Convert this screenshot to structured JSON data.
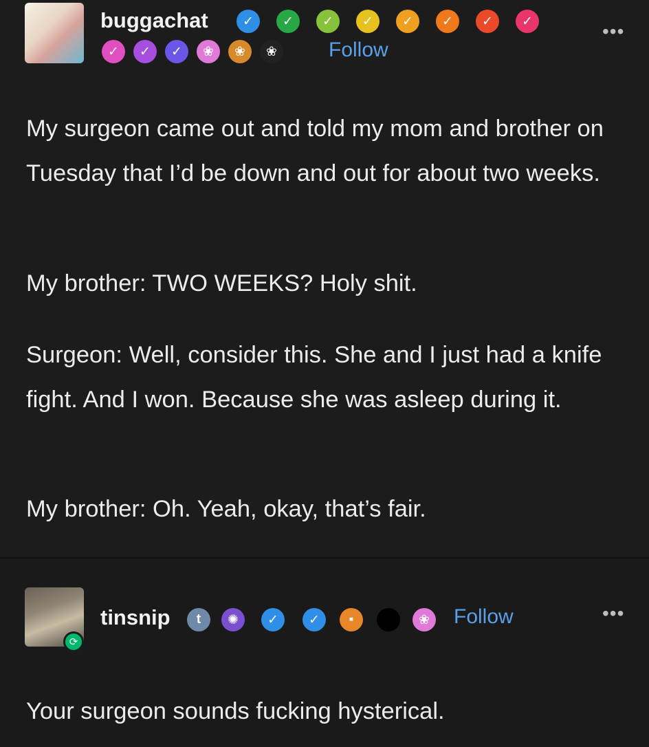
{
  "post1": {
    "username": "buggachat",
    "follow_label": "Follow",
    "more_label": "•••",
    "badges": [
      {
        "icon": "check-badge-icon",
        "color": "#2f8fe6",
        "glyph": "✓"
      },
      {
        "icon": "check-badge-icon",
        "color": "#27a844",
        "glyph": "✓"
      },
      {
        "icon": "check-badge-icon",
        "color": "#86c23a",
        "glyph": "✓"
      },
      {
        "icon": "check-badge-icon",
        "color": "#e6c21f",
        "glyph": "✓"
      },
      {
        "icon": "check-badge-icon",
        "color": "#f0a020",
        "glyph": "✓"
      },
      {
        "icon": "check-badge-icon",
        "color": "#f07a1a",
        "glyph": "✓"
      },
      {
        "icon": "check-badge-icon",
        "color": "#ea4a2a",
        "glyph": "✓"
      },
      {
        "icon": "check-badge-icon",
        "color": "#e8366a",
        "glyph": "✓"
      },
      {
        "icon": "check-badge-icon",
        "color": "#e04fc0",
        "glyph": "✓"
      },
      {
        "icon": "check-badge-icon",
        "color": "#a54ee0",
        "glyph": "✓"
      },
      {
        "icon": "check-badge-icon",
        "color": "#6a56e8",
        "glyph": "✓"
      },
      {
        "icon": "paw-badge-icon",
        "color": "#e07ad8",
        "glyph": "❀"
      },
      {
        "icon": "paw-badge-icon",
        "color": "#d68a2a",
        "glyph": "❀"
      },
      {
        "icon": "paw-badge-icon",
        "color": "#222222",
        "glyph": "❀"
      }
    ],
    "paragraphs": [
      "My surgeon came out and told my mom and brother on Tuesday that I’d be down and out for about two weeks.",
      "My brother: TWO WEEKS? Holy shit.",
      "Surgeon: Well, consider this.  She and I just had a knife fight.  And I won.  Because she was asleep during it.",
      "My brother: Oh.  Yeah, okay, that’s fair."
    ]
  },
  "post2": {
    "username": "tinsnip",
    "follow_label": "Follow",
    "more_label": "•••",
    "reblog_icon": "reblog-icon",
    "badges": [
      {
        "icon": "tumblr-badge-icon",
        "color": "#6f8aa8",
        "glyph": "t"
      },
      {
        "icon": "crab-badge-icon",
        "color": "#7a4fd0",
        "glyph": "✺"
      },
      {
        "icon": "check-badge-icon",
        "color": "#2f8fe6",
        "glyph": "✓"
      },
      {
        "icon": "check-badge-icon",
        "color": "#2f8fe6",
        "glyph": "✓"
      },
      {
        "icon": "orange-badge-icon",
        "color": "#e8872a",
        "glyph": "▪"
      },
      {
        "icon": "black-badge-icon",
        "color": "#000000",
        "glyph": ""
      },
      {
        "icon": "paw-badge-icon",
        "color": "#e07ad8",
        "glyph": "❀"
      }
    ],
    "paragraphs": [
      "Your surgeon sounds fucking hysterical."
    ]
  }
}
